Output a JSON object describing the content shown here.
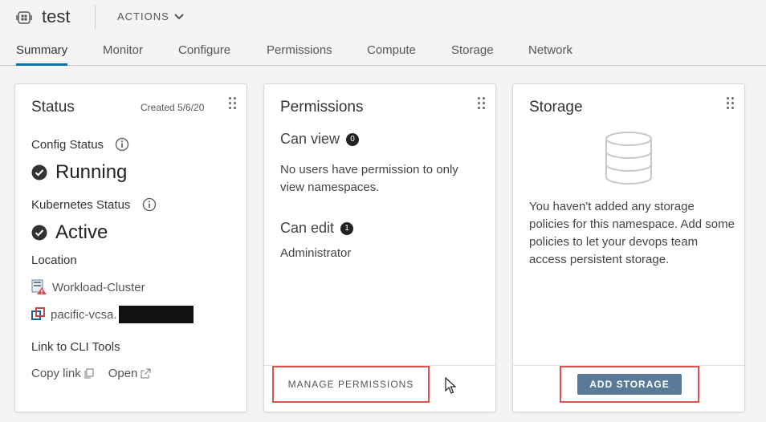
{
  "header": {
    "title": "test",
    "actions_label": "ACTIONS"
  },
  "tabs": [
    {
      "label": "Summary",
      "active": true
    },
    {
      "label": "Monitor"
    },
    {
      "label": "Configure"
    },
    {
      "label": "Permissions"
    },
    {
      "label": "Compute"
    },
    {
      "label": "Storage"
    },
    {
      "label": "Network"
    }
  ],
  "status_card": {
    "title": "Status",
    "created": "Created 5/6/20",
    "config_status_label": "Config Status",
    "config_status_value": "Running",
    "k8s_status_label": "Kubernetes Status",
    "k8s_status_value": "Active",
    "location_label": "Location",
    "cluster_name": "Workload-Cluster",
    "vcsa_name": "pacific-vcsa.",
    "cli_label": "Link to CLI Tools",
    "copy_link": "Copy link",
    "open_link": "Open"
  },
  "permissions_card": {
    "title": "Permissions",
    "can_view_label": "Can view",
    "can_view_count": "0",
    "can_view_text": "No users have permission to only view namespaces.",
    "can_edit_label": "Can edit",
    "can_edit_count": "1",
    "can_edit_text": "Administrator",
    "manage_button": "MANAGE PERMISSIONS"
  },
  "storage_card": {
    "title": "Storage",
    "empty_text": "You haven't added any storage policies for this namespace. Add some policies to let your devops team access persistent storage.",
    "add_button": "ADD STORAGE"
  },
  "colors": {
    "accent": "#0072a3",
    "highlight_border": "#d9534f",
    "button_bg": "#5a7a98"
  }
}
